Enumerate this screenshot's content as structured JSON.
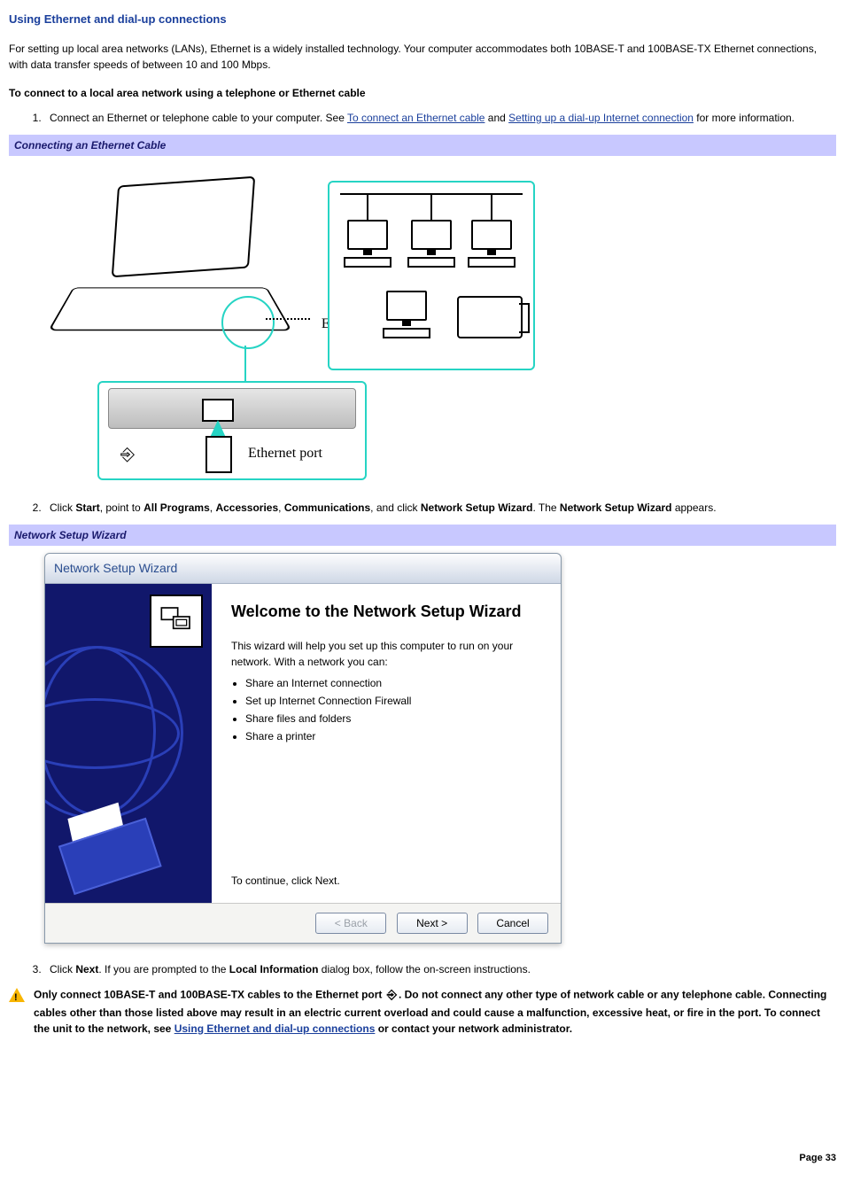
{
  "title": "Using Ethernet and dial-up connections",
  "intro": "For setting up local area networks (LANs), Ethernet is a widely installed technology. Your computer accommodates both 10BASE-T and 100BASE-TX Ethernet connections, with data transfer speeds of between 10 and 100 Mbps.",
  "subhead": "To connect to a local area network using a telephone or Ethernet cable",
  "step1": {
    "pre": "Connect an Ethernet or telephone cable to your computer. See ",
    "link1": "To connect an Ethernet cable",
    "mid": " and ",
    "link2": "Setting up a dial-up Internet connection",
    "post": " for more information."
  },
  "caption_ethernet": "Connecting an Ethernet Cable",
  "eth_labels": {
    "cable": "Ethernet\ncable",
    "port": "Ethernet port",
    "glyph": "⑃"
  },
  "step2": {
    "t1": "Click ",
    "b1": "Start",
    "t2": ", point to ",
    "b2": "All Programs",
    "t3": ", ",
    "b3": "Accessories",
    "t4": ", ",
    "b4": "Communications",
    "t5": ", and click ",
    "b5": "Network Setup Wizard",
    "t6": ". The ",
    "b6": "Network Setup Wizard",
    "t7": " appears."
  },
  "caption_wizard": "Network Setup Wizard",
  "wizard": {
    "title": "Network Setup Wizard",
    "heading": "Welcome to the Network Setup Wizard",
    "desc": "This wizard will help you set up this computer to run on your network. With a network you can:",
    "bullets": [
      "Share an Internet connection",
      "Set up Internet Connection Firewall",
      "Share files and folders",
      "Share a printer"
    ],
    "continue": "To continue, click Next.",
    "buttons": {
      "back": "< Back",
      "next": "Next >",
      "cancel": "Cancel"
    }
  },
  "step3": {
    "t1": "Click ",
    "b1": "Next",
    "t2": ". If you are prompted to the ",
    "b2": "Local Information",
    "t3": " dialog box, follow the on-screen instructions."
  },
  "warning": {
    "pre": "Only connect 10BASE-T and 100BASE-TX cables to the Ethernet port ",
    "mid": ". Do not connect any other type of network cable or any telephone cable. Connecting cables other than those listed above may result in an electric current overload and could cause a malfunction, excessive heat, or fire in the port. To connect the unit to the network, see ",
    "link": "Using Ethernet and dial-up connections",
    "post": " or contact your network administrator."
  },
  "icons": {
    "warning": "warning-triangle-icon",
    "computers": "computers-icon",
    "globe": "globe-icon",
    "printer": "printer-icon",
    "network_port": "network-port-glyph"
  },
  "page_number": "Page 33"
}
